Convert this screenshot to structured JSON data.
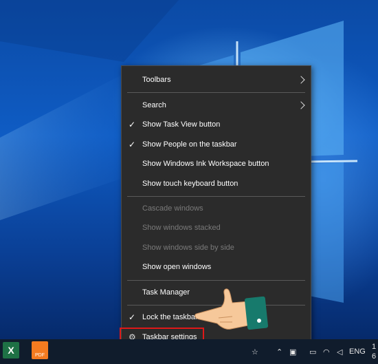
{
  "menu": {
    "items": [
      {
        "label": "Toolbars",
        "checked": false,
        "submenu": true,
        "disabled": false
      },
      {
        "label": "Search",
        "checked": false,
        "submenu": true,
        "disabled": false
      },
      {
        "label": "Show Task View button",
        "checked": true,
        "submenu": false,
        "disabled": false
      },
      {
        "label": "Show People on the taskbar",
        "checked": true,
        "submenu": false,
        "disabled": false
      },
      {
        "label": "Show Windows Ink Workspace button",
        "checked": false,
        "submenu": false,
        "disabled": false
      },
      {
        "label": "Show touch keyboard button",
        "checked": false,
        "submenu": false,
        "disabled": false
      },
      {
        "label": "Cascade windows",
        "checked": false,
        "submenu": false,
        "disabled": true
      },
      {
        "label": "Show windows stacked",
        "checked": false,
        "submenu": false,
        "disabled": true
      },
      {
        "label": "Show windows side by side",
        "checked": false,
        "submenu": false,
        "disabled": true
      },
      {
        "label": "Show open windows",
        "checked": false,
        "submenu": false,
        "disabled": false
      },
      {
        "label": "Task Manager",
        "checked": false,
        "submenu": false,
        "disabled": false
      },
      {
        "label": "Lock the taskbar",
        "checked": true,
        "submenu": false,
        "disabled": false
      },
      {
        "label": "Taskbar settings",
        "checked": false,
        "submenu": false,
        "disabled": false,
        "icon": "gear-icon"
      }
    ]
  },
  "taskbar": {
    "apps": [
      {
        "name": "excel",
        "icon_text": "X"
      },
      {
        "name": "foxit-pdf",
        "icon_text": "PDF"
      }
    ],
    "tray": {
      "language": "ENG",
      "clock_time": "1",
      "clock_date": "6"
    }
  },
  "colors": {
    "menu_bg": "#2b2b2b",
    "highlight_border": "#e01818",
    "taskbar_bg": "#101c2c"
  }
}
